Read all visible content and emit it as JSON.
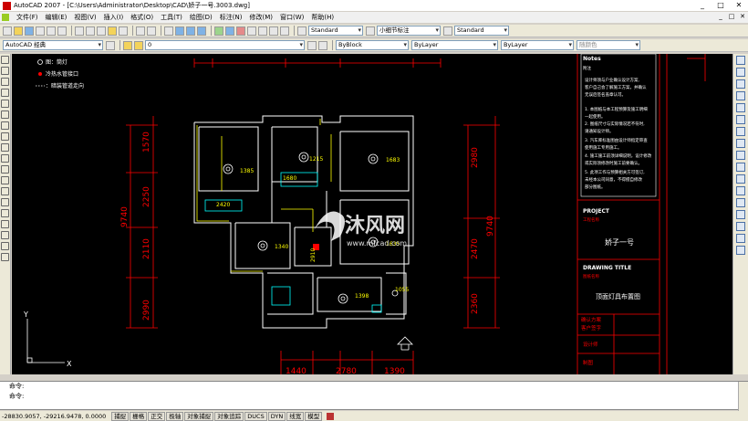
{
  "window": {
    "title": "AutoCAD 2007 - [C:\\Users\\Administrator\\Desktop\\CAD\\娇子一号.3003.dwg]",
    "buttons": [
      "_",
      "□",
      "✕"
    ]
  },
  "menu": {
    "items": [
      "文件(F)",
      "编辑(E)",
      "视图(V)",
      "插入(I)",
      "格式(O)",
      "工具(T)",
      "绘图(D)",
      "标注(N)",
      "修改(M)",
      "窗口(W)",
      "帮助(H)"
    ]
  },
  "toolbar2": {
    "layer_value": "0",
    "text_style": "Standard",
    "dim_style": "小细节标注",
    "table_style": "Standard"
  },
  "toolbar3": {
    "workspace": "AutoCAD 经典",
    "color": "ByBlock",
    "linetype": "ByLayer",
    "lineweight": "ByLayer",
    "plotstyle": "随颜色"
  },
  "drawing": {
    "legend": [
      "图：筒灯",
      "冷热水管接口",
      "：暗装管道走向"
    ],
    "dims_left": [
      "9740",
      "1570",
      "2250",
      "2110",
      "2990"
    ],
    "dims_right": [
      "9740",
      "2980",
      "2470",
      "2360"
    ],
    "dims_bottom": [
      "1440",
      "2780",
      "1390"
    ],
    "room_labels": [
      "1385",
      "1215",
      "1683",
      "1680",
      "1635",
      "1340",
      "2420",
      "2910",
      "1398",
      "1055"
    ],
    "watermark": {
      "brand": "沐风网",
      "url": "www.mfcad.com"
    },
    "title_block": {
      "notes_title": "Notes",
      "notes_sub": "附注",
      "notes_lines": [
        "设计师须与户业确认设计方案,",
        "客户自己会了解施工方案，并确认",
        "无误后签名盖章认可。",
        "1. 本图纸与本工程预算及施工明细",
        "   一起使用。",
        "2. 图纸尺寸与实际情况若不符时,",
        "   请通知设计师。",
        "3. 汽车库标准图由设计师指定审查",
        "   使用施工专用施工。",
        "4. 施工施工前须详细说明，设计修改",
        "   或实际须修改时施工前要确认。",
        "5. 此项工作与预算相关方可签订,",
        "   未经本公司同意，不得擅自修改",
        "   部分图纸。"
      ],
      "project_label": "PROJECT",
      "project_sub": "工程名称",
      "project_name": "娇子一号",
      "drawing_title_label": "DRAWING TITLE",
      "drawing_title_sub": "图纸名称",
      "drawing_title": "顶面灯具布置图",
      "signature_rows": [
        "确认方案",
        "客户签字",
        "设计师",
        "制图"
      ]
    },
    "ucs": {
      "x": "X",
      "y": "Y"
    }
  },
  "command": {
    "lines": [
      "命令:",
      "命令:"
    ]
  },
  "status": {
    "coords": "-28830.9057, -29216.9478, 0.0000",
    "toggles": [
      "捕捉",
      "栅格",
      "正交",
      "极轴",
      "对象捕捉",
      "对象追踪",
      "DUCS",
      "DYN",
      "线宽",
      "模型"
    ]
  },
  "colors": {
    "canvas": "#000000",
    "wall": "#ffffff",
    "dimension": "#ff0000",
    "yellow": "#ffff00",
    "cyan": "#00ffff"
  }
}
